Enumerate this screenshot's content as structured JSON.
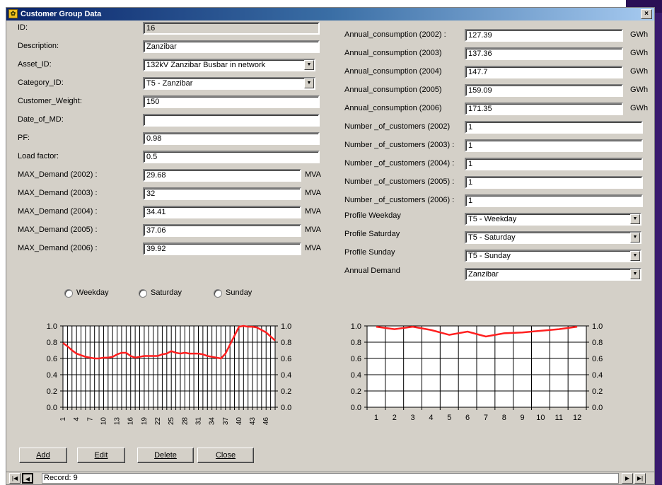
{
  "window": {
    "title": "Customer Group Data",
    "close_label": "×"
  },
  "left_fields": [
    {
      "label": "ID:",
      "value": "16",
      "readonly": true
    },
    {
      "label": "Description:",
      "value": "Zanzibar"
    },
    {
      "label": "Asset_ID:",
      "value": "132kV Zanzibar Busbar in network",
      "dropdown": true
    },
    {
      "label": "Category_ID:",
      "value": "T5 - Zanzibar",
      "dropdown": true
    },
    {
      "label": "Customer_Weight:",
      "value": "150"
    },
    {
      "label": "Date_of_MD:",
      "value": ""
    },
    {
      "label": "PF:",
      "value": "0.98"
    },
    {
      "label": "Load factor:",
      "value": "0.5"
    }
  ],
  "max_demand": [
    {
      "label": "MAX_Demand (2002) :",
      "value": "29.68",
      "unit": "MVA"
    },
    {
      "label": "MAX_Demand (2003) :",
      "value": "32",
      "unit": "MVA"
    },
    {
      "label": "MAX_Demand (2004) :",
      "value": "34.41",
      "unit": "MVA"
    },
    {
      "label": "MAX_Demand (2005) :",
      "value": "37.06",
      "unit": "MVA"
    },
    {
      "label": "MAX_Demand (2006) :",
      "value": "39.92",
      "unit": "MVA"
    }
  ],
  "annual_consumption": [
    {
      "label": "Annual_consumption (2002) :",
      "value": "127.39",
      "unit": "GWh"
    },
    {
      "label": "Annual_consumption (2003)",
      "value": "137.36",
      "unit": "GWh"
    },
    {
      "label": "Annual_consumption (2004)",
      "value": "147.7",
      "unit": "GWh"
    },
    {
      "label": "Annual_consumption (2005)",
      "value": "159.09",
      "unit": "GWh"
    },
    {
      "label": "Annual_consumption (2006)",
      "value": "171.35",
      "unit": "GWh"
    }
  ],
  "customers": [
    {
      "label": "Number _of_customers (2002)",
      "value": "1"
    },
    {
      "label": "Number _of_customers (2003) :",
      "value": "1"
    },
    {
      "label": "Number _of_customers (2004) :",
      "value": "1"
    },
    {
      "label": "Number _of_customers (2005) :",
      "value": "1"
    },
    {
      "label": "Number _of_customers (2006) :",
      "value": "1"
    }
  ],
  "profiles": [
    {
      "label": "Profile Weekday",
      "value": "T5 - Weekday"
    },
    {
      "label": "Profile Saturday",
      "value": "T5 - Saturday"
    },
    {
      "label": "Profile Sunday",
      "value": "T5 - Sunday"
    },
    {
      "label": "Annual Demand",
      "value": "Zanzibar"
    }
  ],
  "radios": [
    "Weekday",
    "Saturday",
    "Sunday"
  ],
  "buttons": {
    "add": "Add",
    "edit": "Edit",
    "delete": "Delete",
    "close": "Close"
  },
  "record": {
    "text": "Record: 9"
  },
  "colors": {
    "line": "#ff2020",
    "window_bg": "#d4d0c8"
  },
  "chart_data": [
    {
      "type": "line",
      "x_ticks": [
        "1",
        "4",
        "7",
        "10",
        "13",
        "16",
        "19",
        "22",
        "25",
        "28",
        "31",
        "34",
        "37",
        "40",
        "43",
        "46"
      ],
      "y_ticks": [
        "0.0",
        "0.2",
        "0.4",
        "0.6",
        "0.8",
        "1.0"
      ],
      "ylim": [
        0,
        1
      ],
      "grid": true,
      "series": [
        {
          "x": [
            1,
            2,
            3,
            4,
            5,
            6,
            7,
            8,
            9,
            10,
            11,
            12,
            13,
            14,
            15,
            16,
            17,
            18,
            19,
            20,
            21,
            22,
            23,
            24,
            25,
            26,
            27,
            28,
            29,
            30,
            31,
            32,
            33,
            34,
            35,
            36,
            37,
            38,
            39,
            40,
            41,
            42,
            43,
            44,
            45,
            46,
            47,
            48
          ],
          "values": [
            0.79,
            0.75,
            0.7,
            0.66,
            0.64,
            0.62,
            0.61,
            0.6,
            0.6,
            0.61,
            0.61,
            0.62,
            0.65,
            0.67,
            0.67,
            0.63,
            0.61,
            0.62,
            0.63,
            0.63,
            0.63,
            0.63,
            0.65,
            0.66,
            0.69,
            0.67,
            0.66,
            0.67,
            0.66,
            0.66,
            0.66,
            0.65,
            0.63,
            0.62,
            0.61,
            0.6,
            0.66,
            0.77,
            0.88,
            0.99,
            1.0,
            0.99,
            0.99,
            0.98,
            0.95,
            0.92,
            0.87,
            0.82
          ]
        }
      ]
    },
    {
      "type": "line",
      "x_ticks": [
        "1",
        "2",
        "3",
        "4",
        "5",
        "6",
        "7",
        "8",
        "9",
        "10",
        "11",
        "12"
      ],
      "y_ticks": [
        "0.0",
        "0.2",
        "0.4",
        "0.6",
        "0.8",
        "1.0"
      ],
      "ylim": [
        0,
        1
      ],
      "grid": true,
      "series": [
        {
          "x": [
            1,
            2,
            3,
            4,
            5,
            6,
            7,
            8,
            9,
            10,
            11,
            12
          ],
          "values": [
            0.99,
            0.96,
            0.99,
            0.95,
            0.89,
            0.93,
            0.87,
            0.91,
            0.92,
            0.94,
            0.96,
            0.99
          ]
        }
      ]
    }
  ]
}
